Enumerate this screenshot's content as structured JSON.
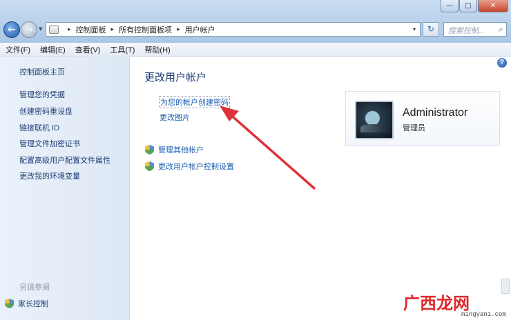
{
  "window": {
    "minimize_label": "—",
    "maximize_label": "□",
    "close_label": "✕"
  },
  "address_bar": {
    "crumbs": [
      "控制面板",
      "所有控制面板项",
      "用户帐户"
    ],
    "separator": "▸",
    "dropdown": "▾"
  },
  "search": {
    "placeholder": "搜索控制..."
  },
  "menu": [
    "文件(F)",
    "编辑(E)",
    "查看(V)",
    "工具(T)",
    "帮助(H)"
  ],
  "sidebar": {
    "home": "控制面板主页",
    "items": [
      "管理您的凭据",
      "创建密码重设盘",
      "链接联机 ID",
      "管理文件加密证书",
      "配置高级用户配置文件属性",
      "更改我的环境变量"
    ],
    "see_also_heading": "另请参阅",
    "see_also_items": [
      "家长控制"
    ]
  },
  "main": {
    "title": "更改用户帐户",
    "links": [
      "为您的帐户创建密码",
      "更改图片"
    ],
    "shield_links": [
      "管理其他帐户",
      "更改用户帐户控制设置"
    ]
  },
  "user": {
    "name": "Administrator",
    "role": "管理员"
  },
  "watermark": {
    "text": "广西龙网",
    "url": "mingyan1.com"
  },
  "colors": {
    "arrow": "#e0323a",
    "link": "#1e5fb4",
    "heading": "#1e3d74"
  }
}
